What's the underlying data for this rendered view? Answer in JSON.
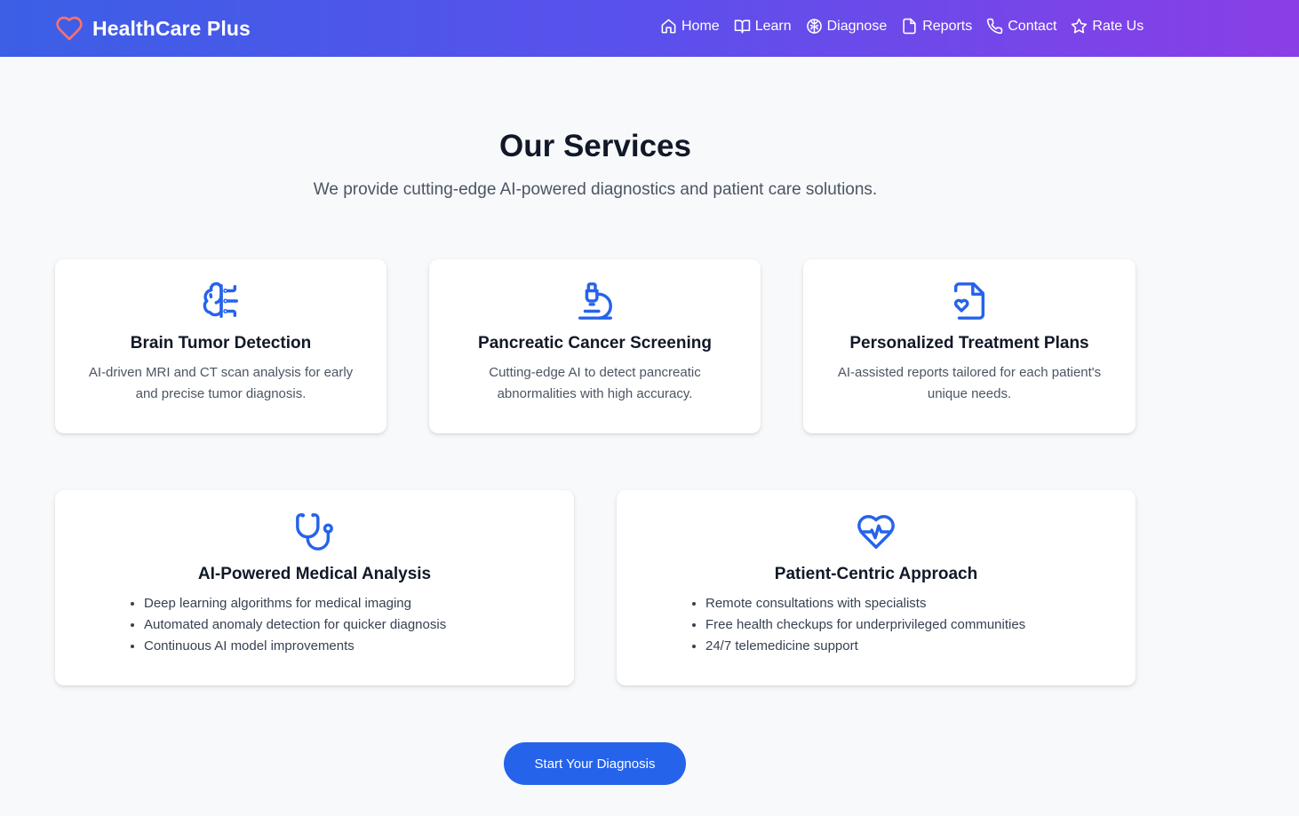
{
  "brand": {
    "name": "HealthCare Plus",
    "icon": "heart-icon",
    "icon_color": "#f87171"
  },
  "nav": [
    {
      "label": "Home",
      "icon": "home-icon"
    },
    {
      "label": "Learn",
      "icon": "book-icon"
    },
    {
      "label": "Diagnose",
      "icon": "brain-icon"
    },
    {
      "label": "Reports",
      "icon": "file-icon"
    },
    {
      "label": "Contact",
      "icon": "phone-icon"
    },
    {
      "label": "Rate Us",
      "icon": "star-icon"
    }
  ],
  "page": {
    "title": "Our Services",
    "subtitle": "We provide cutting-edge AI-powered diagnostics and patient care solutions."
  },
  "services": [
    {
      "title": "Brain Tumor Detection",
      "description": "AI-driven MRI and CT scan analysis for early and precise tumor diagnosis.",
      "icon": "brain-icon"
    },
    {
      "title": "Pancreatic Cancer Screening",
      "description": "Cutting-edge AI to detect pancreatic abnormalities with high accuracy.",
      "icon": "microscope-icon"
    },
    {
      "title": "Personalized Treatment Plans",
      "description": "AI-assisted reports tailored for each patient's unique needs.",
      "icon": "file-heart-icon"
    }
  ],
  "features": [
    {
      "title": "AI-Powered Medical Analysis",
      "icon": "stethoscope-icon",
      "items": [
        "Deep learning algorithms for medical imaging",
        "Automated anomaly detection for quicker diagnosis",
        "Continuous AI model improvements"
      ]
    },
    {
      "title": "Patient-Centric Approach",
      "icon": "heart-pulse-icon",
      "items": [
        "Remote consultations with specialists",
        "Free health checkups for underprivileged communities",
        "24/7 telemedicine support"
      ]
    }
  ],
  "cta": {
    "label": "Start Your Diagnosis"
  },
  "colors": {
    "accent": "#2563eb",
    "nav_gradient_start": "#3b5fe6",
    "nav_gradient_end": "#8a3ee6",
    "background": "#f8f9fb"
  }
}
